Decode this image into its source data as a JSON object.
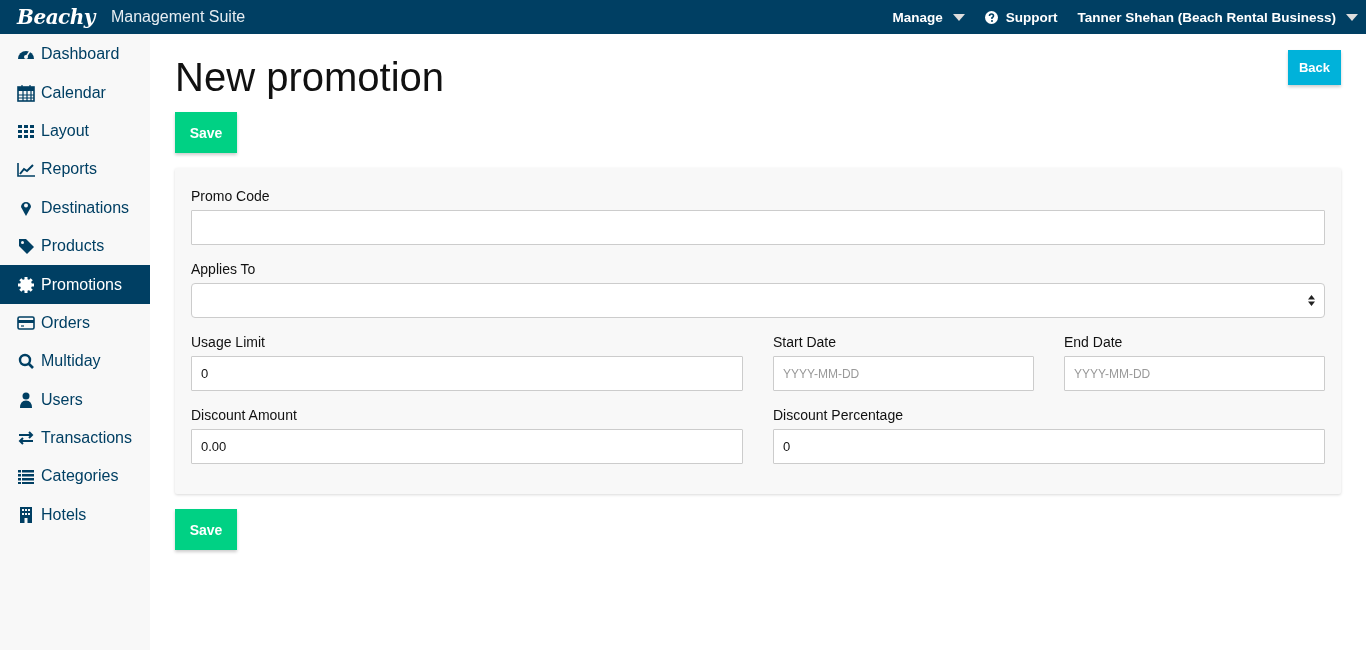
{
  "header": {
    "logo": "Beachy",
    "app_title": "Management Suite",
    "menu": [
      {
        "kind": "dropdown",
        "label": "Manage"
      },
      {
        "kind": "help",
        "label": "Support"
      },
      {
        "kind": "dropdown",
        "label": "Tanner Shehan (Beach Rental Business)"
      }
    ]
  },
  "sidebar": {
    "items": [
      {
        "label": "Dashboard",
        "selected": false
      },
      {
        "label": "Calendar",
        "selected": false
      },
      {
        "label": "Layout",
        "selected": false
      },
      {
        "label": "Reports",
        "selected": false
      },
      {
        "label": "Destinations",
        "selected": false
      },
      {
        "label": "Products",
        "selected": false
      },
      {
        "label": "Promotions",
        "selected": true
      },
      {
        "label": "Orders",
        "selected": false
      },
      {
        "label": "Multiday",
        "selected": false
      },
      {
        "label": "Users",
        "selected": false
      },
      {
        "label": "Transactions",
        "selected": false
      },
      {
        "label": "Categories",
        "selected": false
      },
      {
        "label": "Hotels",
        "selected": false
      }
    ]
  },
  "page": {
    "title": "New promotion",
    "back_button": "Back",
    "save_button_top": "Save",
    "save_button_bottom": "Save"
  },
  "form": {
    "rows": [
      [
        {
          "kind": "text",
          "label": "Promo Code"
        }
      ],
      [
        {
          "kind": "select",
          "label": "Applies To"
        }
      ],
      [
        {
          "kind": "text",
          "label": "Usage Limit",
          "value": "0"
        },
        {
          "kind": "text",
          "label": "Start Date",
          "placeholder": "YYYY-MM-DD"
        },
        {
          "kind": "text",
          "label": "End Date",
          "placeholder": "YYYY-MM-DD"
        }
      ],
      [
        {
          "kind": "text",
          "label": "Discount Amount",
          "value": "0.00"
        },
        {
          "kind": "text",
          "label": "Discount Percentage",
          "value": "0"
        }
      ]
    ]
  }
}
